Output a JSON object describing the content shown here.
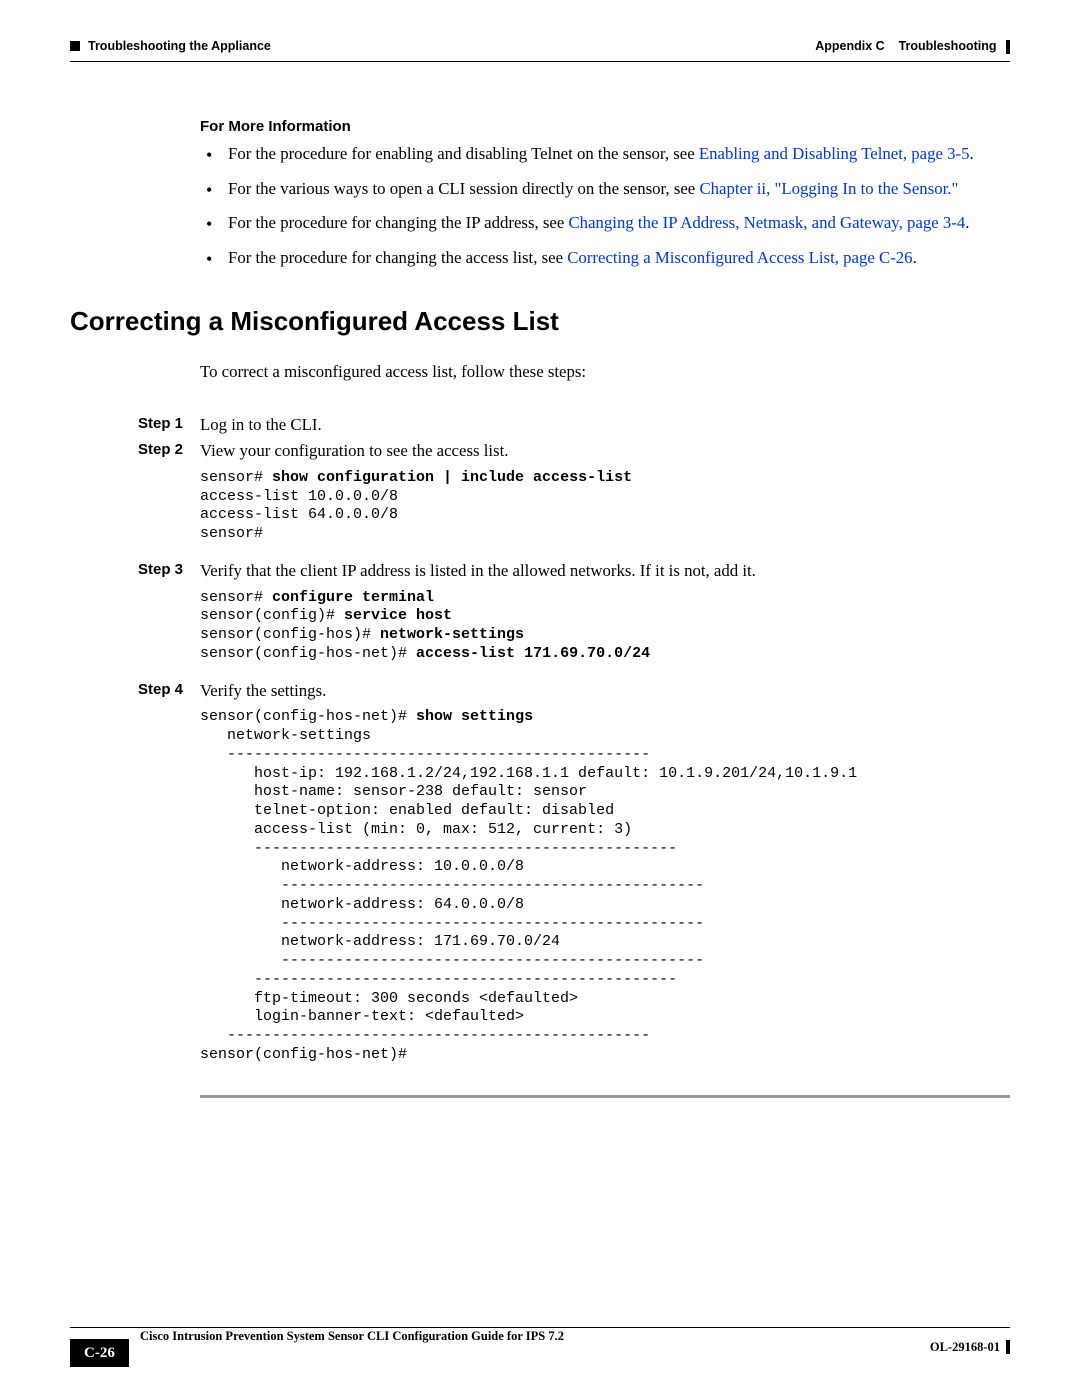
{
  "header": {
    "left": "Troubleshooting the Appliance",
    "right_prefix": "Appendix C",
    "right_title": "Troubleshooting"
  },
  "fmi": {
    "heading": "For More Information",
    "items": [
      {
        "pre": "For the procedure for enabling and disabling Telnet on the sensor, see ",
        "link": "Enabling and Disabling Telnet, page 3-5",
        "post": "."
      },
      {
        "pre": "For the various ways to open a CLI session directly on the sensor, see ",
        "link": "Chapter ii, \"Logging In to the Sensor.\"",
        "post": ""
      },
      {
        "pre": "For the procedure for changing the IP address, see ",
        "link": "Changing the IP Address, Netmask, and Gateway, page 3-4",
        "post": "."
      },
      {
        "pre": "For the procedure for changing the access list, see ",
        "link": "Correcting a Misconfigured Access List, page C-26",
        "post": "."
      }
    ]
  },
  "section_title": "Correcting a Misconfigured Access List",
  "intro": "To correct a misconfigured access list, follow these steps:",
  "steps": {
    "s1": {
      "label": "Step 1",
      "text": "Log in to the CLI."
    },
    "s2": {
      "label": "Step 2",
      "text": "View your configuration to see the access list."
    },
    "s3": {
      "label": "Step 3",
      "text": "Verify that the client IP address is listed in the allowed networks. If it is not, add it."
    },
    "s4": {
      "label": "Step 4",
      "text": "Verify the settings."
    }
  },
  "code": {
    "c1_pre": "sensor# ",
    "c1_bold": "show configuration | include access-list",
    "c1_rest": "\naccess-list 10.0.0.0/8\naccess-list 64.0.0.0/8\nsensor#",
    "c2_l1_pre": "sensor# ",
    "c2_l1_bold": "configure terminal",
    "c2_l2_pre": "sensor(config)# ",
    "c2_l2_bold": "service host",
    "c2_l3_pre": "sensor(config-hos)# ",
    "c2_l3_bold": "network-settings",
    "c2_l4_pre": "sensor(config-hos-net)# ",
    "c2_l4_bold": "access-list 171.69.70.0/24",
    "c3_l1_pre": "sensor(config-hos-net)# ",
    "c3_l1_bold": "show settings",
    "c3_rest": "\n   network-settings\n   -----------------------------------------------\n      host-ip: 192.168.1.2/24,192.168.1.1 default: 10.1.9.201/24,10.1.9.1\n      host-name: sensor-238 default: sensor\n      telnet-option: enabled default: disabled\n      access-list (min: 0, max: 512, current: 3)\n      -----------------------------------------------\n         network-address: 10.0.0.0/8\n         -----------------------------------------------\n         network-address: 64.0.0.0/8\n         -----------------------------------------------\n         network-address: 171.69.70.0/24\n         -----------------------------------------------\n      -----------------------------------------------\n      ftp-timeout: 300 seconds <defaulted>\n      login-banner-text: <defaulted>\n   -----------------------------------------------\nsensor(config-hos-net)#"
  },
  "footer": {
    "title": "Cisco Intrusion Prevention System Sensor CLI Configuration Guide for IPS 7.2",
    "page": "C-26",
    "docnum": "OL-29168-01"
  }
}
